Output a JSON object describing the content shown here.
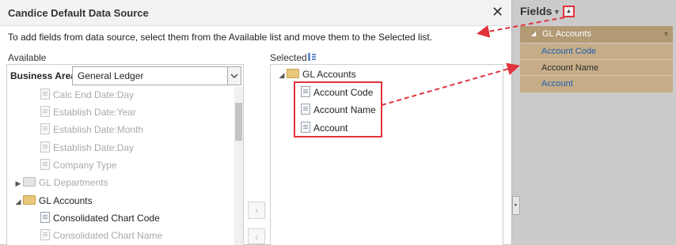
{
  "dialog": {
    "title": "Candice Default Data Source",
    "close_glyph": "✕",
    "instructions": "To add fields from data source, select them from the Available list and move them to the Selected list."
  },
  "available": {
    "label": "Available",
    "business_area_label": "Business Area",
    "business_area_value": "General Ledger",
    "tree": [
      {
        "label": "Calc End Date:Day"
      },
      {
        "label": "Establish Date:Year"
      },
      {
        "label": "Establish Date:Month"
      },
      {
        "label": "Establish Date:Day"
      },
      {
        "label": "Company Type"
      },
      {
        "label": "GL Departments"
      },
      {
        "label": "GL Accounts"
      },
      {
        "label": "Consolidated Chart Code"
      },
      {
        "label": "Consolidated Chart Name"
      }
    ]
  },
  "mover": {
    "add_glyph": "›",
    "remove_glyph": "‹"
  },
  "selected": {
    "label": "Selected",
    "folder": "GL Accounts",
    "items": [
      {
        "label": "Account Code"
      },
      {
        "label": "Account Name"
      },
      {
        "label": "Account"
      }
    ]
  },
  "fields_pane": {
    "title": "Fields",
    "group": "GL Accounts",
    "items": [
      {
        "label": "Account Code"
      },
      {
        "label": "Account Name"
      },
      {
        "label": "Account"
      }
    ]
  },
  "colors": {
    "annotation_red": "#e0333b",
    "group_header": "#b29a74",
    "field_bg": "#c6ad88",
    "link_blue": "#1b5fb5"
  },
  "icons": [
    "close-icon",
    "chevron-down-icon",
    "document-icon",
    "folder-icon",
    "expand-arrow-icon",
    "collapse-arrow-icon",
    "sort-icon"
  ]
}
